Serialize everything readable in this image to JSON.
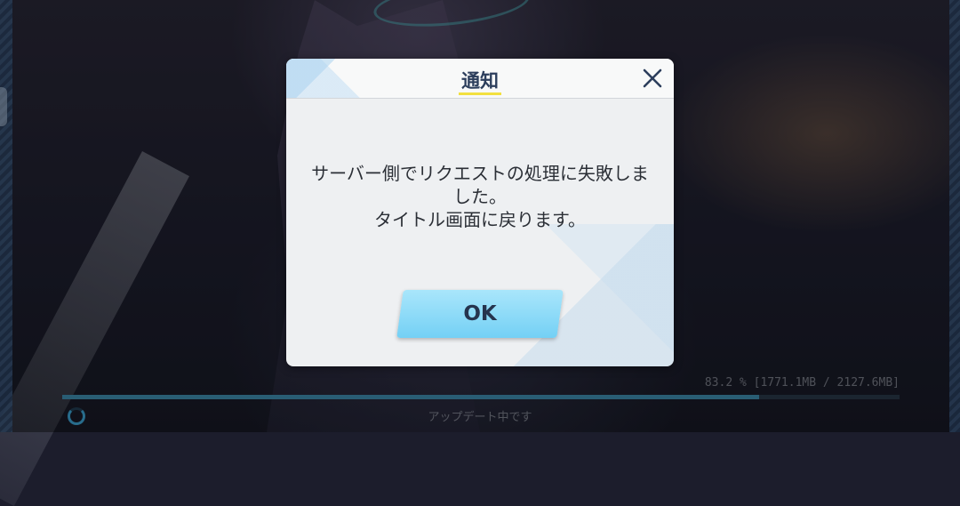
{
  "dialog": {
    "title": "通知",
    "message": "サーバー側でリクエストの処理に失敗しま\nした。\nタイトル画面に戻ります。",
    "ok_label": "OK",
    "close_icon": "close-icon"
  },
  "download": {
    "progress_text": "83.2 % [1771.1MB / 2127.6MB]",
    "progress_fraction": 0.832,
    "status": "アップデート中です"
  },
  "colors": {
    "title_underline": "#f2e040",
    "ok_button": "#74d0f5",
    "progress_fill": "#3f8fb2"
  }
}
